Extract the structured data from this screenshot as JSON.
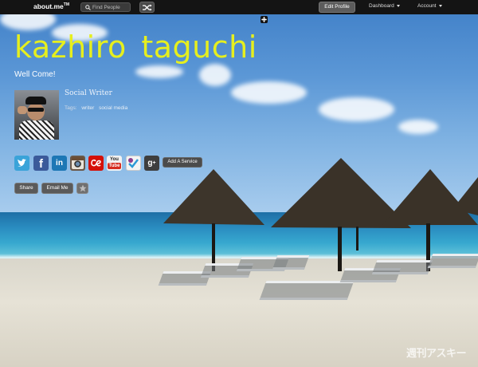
{
  "topbar": {
    "logo": "about.me",
    "logo_tm": "TM",
    "search_placeholder": "Find People",
    "edit_profile": "Edit Profile",
    "dashboard": "Dashboard",
    "account": "Account"
  },
  "profile": {
    "name": "kazhiro taguchi",
    "headline": "Well Come!",
    "role": "Social Writer",
    "tags_label": "Tags:",
    "tags": [
      "writer",
      "social media"
    ]
  },
  "social": {
    "icons": [
      "twitter-icon",
      "facebook-icon",
      "linkedin-icon",
      "instagram-icon",
      "lastfm-icon",
      "youtube-icon",
      "foursquare-icon",
      "google-plus-icon"
    ],
    "youtube_top": "You",
    "youtube_bottom": "Tube",
    "add_service": "Add A Service"
  },
  "actions": {
    "share": "Share",
    "email": "Email Me"
  },
  "watermark": "週刊アスキー",
  "colors": {
    "name_accent": "#e6ef1e",
    "topbar": "#141414"
  }
}
